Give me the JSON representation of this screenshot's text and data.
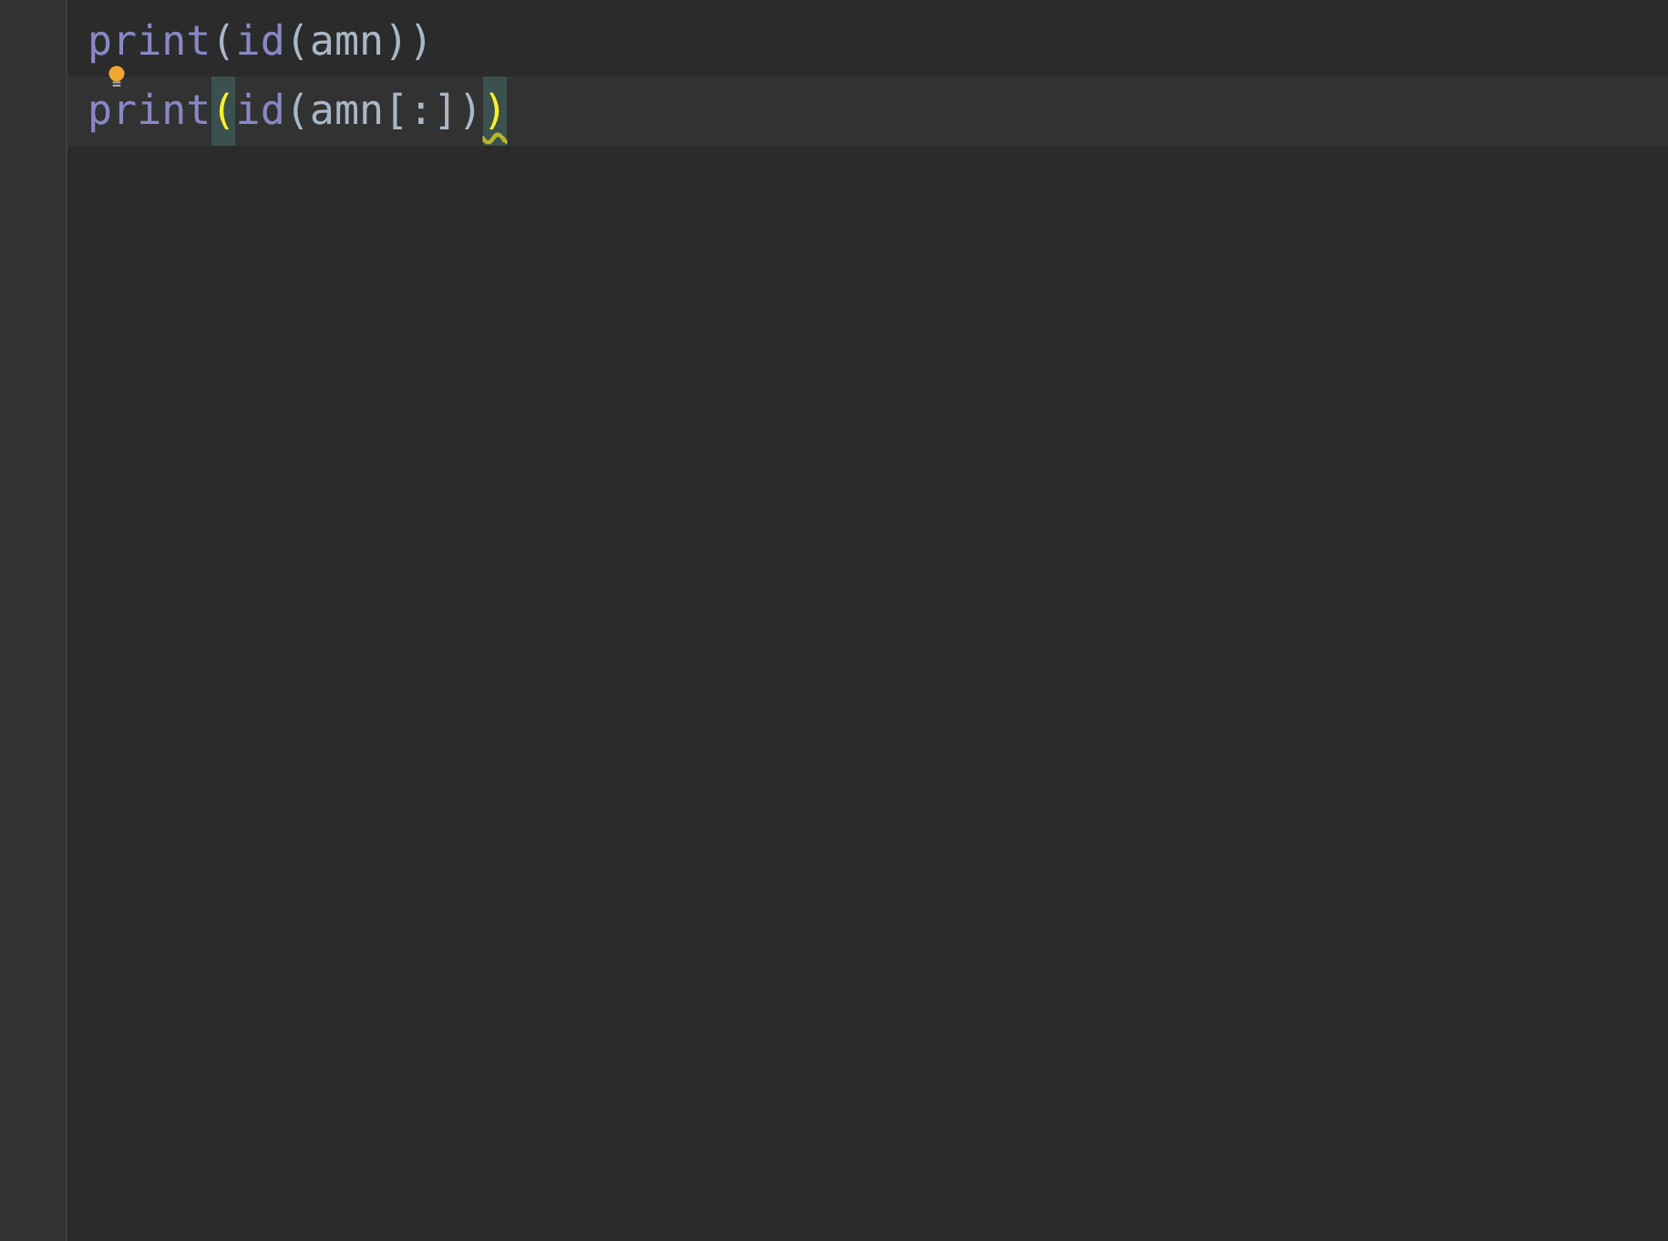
{
  "editor": {
    "lines": [
      {
        "hint_bulb": true,
        "tokens": [
          {
            "kind": "builtin",
            "text": "print"
          },
          {
            "kind": "punct",
            "text": "("
          },
          {
            "kind": "builtin",
            "text": "id"
          },
          {
            "kind": "punct",
            "text": "("
          },
          {
            "kind": "ident",
            "text": "amn"
          },
          {
            "kind": "punct",
            "text": "))"
          }
        ]
      },
      {
        "current": true,
        "tokens": [
          {
            "kind": "builtin",
            "text": "print"
          },
          {
            "kind": "matched",
            "text": "("
          },
          {
            "kind": "builtin",
            "text": "id"
          },
          {
            "kind": "punct",
            "text": "("
          },
          {
            "kind": "ident",
            "text": "amn"
          },
          {
            "kind": "punct",
            "text": "[:])"
          },
          {
            "kind": "matched",
            "text": ")",
            "warning": true
          }
        ]
      }
    ]
  }
}
